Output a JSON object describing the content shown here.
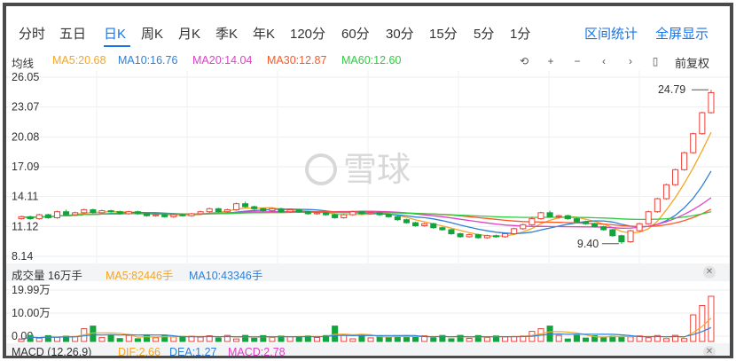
{
  "tabs": [
    {
      "label": "分时"
    },
    {
      "label": "五日"
    },
    {
      "label": "日K"
    },
    {
      "label": "周K"
    },
    {
      "label": "月K"
    },
    {
      "label": "季K"
    },
    {
      "label": "年K"
    },
    {
      "label": "120分"
    },
    {
      "label": "60分"
    },
    {
      "label": "30分"
    },
    {
      "label": "15分"
    },
    {
      "label": "5分"
    },
    {
      "label": "1分"
    }
  ],
  "active_tab": "日K",
  "top_links": {
    "stats": "区间统计",
    "fullscreen": "全屏显示"
  },
  "ma_legend": {
    "label": "均线",
    "items": [
      {
        "text": "MA5:20.68",
        "color": "#f5a623"
      },
      {
        "text": "MA10:16.76",
        "color": "#2f7fd8"
      },
      {
        "text": "MA20:14.04",
        "color": "#e040c8"
      },
      {
        "text": "MA30:12.87",
        "color": "#ff5722"
      },
      {
        "text": "MA60:12.60",
        "color": "#2ecc40"
      }
    ]
  },
  "controls": {
    "icons": [
      "undo-icon",
      "zoom-in-icon",
      "zoom-out-icon",
      "left-icon",
      "right-icon",
      "marker-icon"
    ],
    "glyphs": [
      "⟲",
      "+",
      "−",
      "‹",
      "›",
      "▯"
    ],
    "fq_label": "前复权"
  },
  "price_axis": [
    "26.05",
    "23.07",
    "20.08",
    "17.09",
    "14.11",
    "11.12",
    "8.14"
  ],
  "annotations": {
    "high": "24.79",
    "low": "9.40"
  },
  "watermark": "雪球",
  "volume": {
    "title": "成交量 16万手",
    "ma5": "MA5:82446手",
    "ma10": "MA10:43346手",
    "axis": [
      "19.99万",
      "10.00万",
      "0.00"
    ]
  },
  "macd": {
    "title": "MACD (12,26,9)",
    "dif": "DIF:2.66",
    "dea": "DEA:1.27",
    "macd": "MACD:2.78"
  },
  "colors": {
    "up": "#e8423a",
    "down": "#13a43d",
    "accent": "#1a73e8"
  },
  "chart_data": {
    "type": "candlestick",
    "ylim": [
      8.14,
      26.05
    ],
    "candles": [
      [
        11.9,
        12.1,
        11.8,
        12.2,
        1
      ],
      [
        12.1,
        11.9,
        11.8,
        12.2,
        1
      ],
      [
        11.9,
        12.3,
        11.8,
        12.4,
        1
      ],
      [
        12.3,
        12.0,
        11.9,
        12.4,
        1
      ],
      [
        12.0,
        12.6,
        11.9,
        12.7,
        1
      ],
      [
        12.6,
        12.3,
        12.2,
        12.8,
        1
      ],
      [
        12.3,
        12.5,
        12.2,
        12.6,
        1
      ],
      [
        12.5,
        12.8,
        12.4,
        12.9,
        1
      ],
      [
        12.8,
        12.5,
        12.4,
        12.9,
        1
      ],
      [
        12.5,
        12.7,
        12.4,
        12.8,
        1
      ],
      [
        12.7,
        12.6,
        12.5,
        12.8,
        1
      ],
      [
        12.6,
        12.4,
        12.3,
        12.7,
        1
      ],
      [
        12.4,
        12.6,
        12.3,
        12.7,
        1
      ],
      [
        12.6,
        12.4,
        12.3,
        12.7,
        1
      ],
      [
        12.4,
        12.2,
        12.1,
        12.5,
        1
      ],
      [
        12.2,
        12.3,
        12.1,
        12.4,
        1
      ],
      [
        12.3,
        12.1,
        12.0,
        12.4,
        1
      ],
      [
        12.1,
        12.3,
        12.0,
        12.4,
        1
      ],
      [
        12.3,
        12.2,
        12.1,
        12.4,
        1
      ],
      [
        12.2,
        12.4,
        12.1,
        12.5,
        1
      ],
      [
        12.4,
        12.6,
        12.3,
        12.7,
        1
      ],
      [
        12.6,
        12.9,
        12.5,
        13.0,
        1
      ],
      [
        12.9,
        12.6,
        12.5,
        13.0,
        1
      ],
      [
        12.6,
        12.8,
        12.5,
        12.9,
        1
      ],
      [
        12.8,
        13.4,
        12.7,
        13.5,
        1
      ],
      [
        13.4,
        13.1,
        13.0,
        13.6,
        1
      ],
      [
        13.1,
        12.9,
        12.8,
        13.2,
        1
      ],
      [
        12.9,
        12.7,
        12.6,
        13.0,
        1
      ],
      [
        12.7,
        12.9,
        12.6,
        13.0,
        1
      ],
      [
        12.9,
        12.6,
        12.5,
        13.0,
        1
      ],
      [
        12.6,
        12.8,
        12.5,
        12.9,
        1
      ],
      [
        12.8,
        12.6,
        12.5,
        12.9,
        1
      ],
      [
        12.6,
        12.4,
        12.3,
        12.7,
        1
      ],
      [
        12.4,
        12.5,
        12.3,
        12.6,
        1
      ],
      [
        12.5,
        12.3,
        12.2,
        12.6,
        1
      ],
      [
        12.3,
        12.0,
        11.9,
        12.4,
        1
      ],
      [
        12.0,
        12.3,
        11.9,
        12.4,
        1
      ],
      [
        12.3,
        12.6,
        12.2,
        12.7,
        1
      ],
      [
        12.6,
        12.4,
        12.3,
        12.7,
        1
      ],
      [
        12.4,
        12.5,
        12.3,
        12.6,
        1
      ],
      [
        12.5,
        12.3,
        12.2,
        12.6,
        1
      ],
      [
        12.3,
        12.1,
        12.0,
        12.4,
        1
      ],
      [
        12.1,
        11.8,
        11.7,
        12.2,
        1
      ],
      [
        11.8,
        11.5,
        11.4,
        11.9,
        1
      ],
      [
        11.5,
        11.2,
        11.1,
        11.6,
        1
      ],
      [
        11.2,
        11.4,
        11.1,
        11.5,
        1
      ],
      [
        11.4,
        11.0,
        10.9,
        11.5,
        1
      ],
      [
        11.0,
        10.8,
        10.7,
        11.1,
        1
      ],
      [
        10.8,
        10.4,
        10.3,
        10.9,
        1
      ],
      [
        10.4,
        10.1,
        10.0,
        10.5,
        1
      ],
      [
        10.1,
        10.3,
        10.0,
        10.4,
        1
      ],
      [
        10.3,
        10.0,
        9.9,
        10.4,
        1
      ],
      [
        10.0,
        10.2,
        9.9,
        10.3,
        1
      ],
      [
        10.2,
        10.1,
        10.0,
        10.3,
        1
      ],
      [
        10.1,
        10.4,
        10.0,
        10.5,
        1
      ],
      [
        10.4,
        10.9,
        10.3,
        11.0,
        1
      ],
      [
        10.9,
        11.3,
        10.8,
        11.4,
        1
      ],
      [
        11.3,
        11.9,
        11.2,
        12.1,
        1
      ],
      [
        11.9,
        12.5,
        11.8,
        12.6,
        1
      ],
      [
        12.5,
        12.1,
        12.0,
        12.7,
        1
      ],
      [
        12.1,
        12.2,
        11.9,
        12.3,
        1
      ],
      [
        12.2,
        11.9,
        11.8,
        12.3,
        1
      ],
      [
        11.9,
        11.6,
        11.5,
        12.0,
        1
      ],
      [
        11.6,
        11.4,
        11.3,
        11.7,
        1
      ],
      [
        11.4,
        11.1,
        11.0,
        11.5,
        1
      ],
      [
        11.1,
        10.8,
        10.7,
        11.2,
        1
      ],
      [
        10.8,
        10.2,
        10.1,
        10.9,
        1
      ],
      [
        10.2,
        9.6,
        9.4,
        10.3,
        1
      ],
      [
        9.6,
        10.7,
        9.5,
        10.8,
        1
      ],
      [
        10.7,
        11.4,
        10.6,
        11.5,
        1
      ],
      [
        11.4,
        12.6,
        11.3,
        12.7,
        1
      ],
      [
        12.6,
        13.9,
        12.5,
        14.0,
        1
      ],
      [
        13.9,
        15.3,
        13.8,
        15.4,
        1
      ],
      [
        15.3,
        16.8,
        15.2,
        16.9,
        1
      ],
      [
        16.8,
        18.5,
        16.7,
        18.6,
        1
      ],
      [
        18.5,
        20.4,
        18.4,
        20.5,
        1
      ],
      [
        20.4,
        22.5,
        20.3,
        22.6,
        1
      ],
      [
        22.5,
        24.5,
        22.4,
        24.79,
        1
      ]
    ]
  }
}
